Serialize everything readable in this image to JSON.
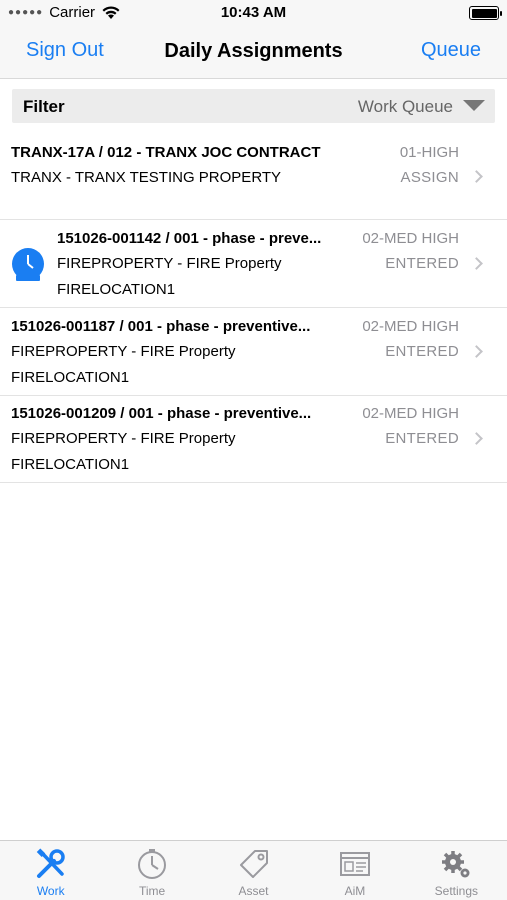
{
  "status_bar": {
    "carrier": "Carrier",
    "time": "10:43 AM"
  },
  "nav": {
    "left_label": "Sign Out",
    "title": "Daily Assignments",
    "right_label": "Queue"
  },
  "filter": {
    "label": "Filter",
    "value": "Work Queue"
  },
  "assignments": [
    {
      "title": "TRANX-17A / 012 - TRANX JOC CONTRACT",
      "property": "TRANX - TRANX TESTING PROPERTY",
      "location": "",
      "priority": "01-HIGH",
      "status": "ASSIGN",
      "icon": ""
    },
    {
      "title": "151026-001142 / 001 - phase - preve...",
      "property": "FIREPROPERTY - FIRE Property",
      "location": "FIRELOCATION1",
      "priority": "02-MED HIGH",
      "status": "ENTERED",
      "icon": "clock-icon"
    },
    {
      "title": "151026-001187 / 001 - phase - preventive...",
      "property": "FIREPROPERTY - FIRE Property",
      "location": "FIRELOCATION1",
      "priority": "02-MED HIGH",
      "status": "ENTERED",
      "icon": ""
    },
    {
      "title": "151026-001209 / 001 - phase - preventive...",
      "property": "FIREPROPERTY - FIRE Property",
      "location": "FIRELOCATION1",
      "priority": "02-MED HIGH",
      "status": "ENTERED",
      "icon": ""
    }
  ],
  "tabs": [
    {
      "label": "Work",
      "icon": "wrench-screwdriver-icon",
      "active": true
    },
    {
      "label": "Time",
      "icon": "stopwatch-icon",
      "active": false
    },
    {
      "label": "Asset",
      "icon": "tag-icon",
      "active": false
    },
    {
      "label": "AiM",
      "icon": "browser-window-icon",
      "active": false
    },
    {
      "label": "Settings",
      "icon": "gears-icon",
      "active": false
    }
  ],
  "colors": {
    "accent": "#1a7ef2",
    "secondary_text": "#8e8e93",
    "bar_background": "#f7f7f7"
  }
}
